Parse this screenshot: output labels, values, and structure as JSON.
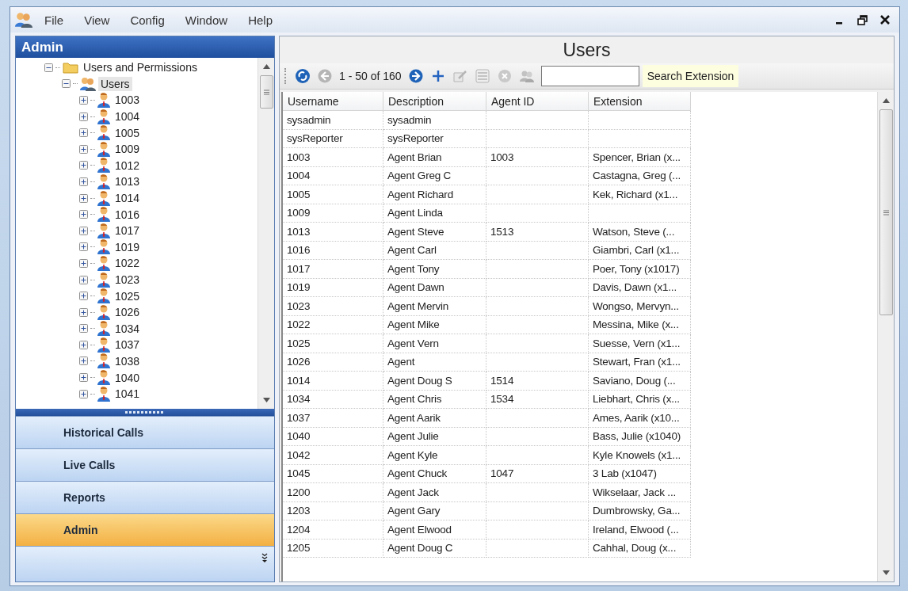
{
  "menu": {
    "items": [
      "File",
      "View",
      "Config",
      "Window",
      "Help"
    ]
  },
  "sidebar": {
    "title": "Admin",
    "tree": [
      {
        "label": "Users and Permissions",
        "kind": "folder",
        "expanded": true,
        "selected": false,
        "children": [
          {
            "label": "Users",
            "kind": "group",
            "expanded": true,
            "selected": true,
            "children": [
              {
                "label": "1003",
                "kind": "user",
                "expanded": false,
                "selected": false
              },
              {
                "label": "1004",
                "kind": "user",
                "expanded": false,
                "selected": false
              },
              {
                "label": "1005",
                "kind": "user",
                "expanded": false,
                "selected": false
              },
              {
                "label": "1009",
                "kind": "user",
                "expanded": false,
                "selected": false
              },
              {
                "label": "1012",
                "kind": "user",
                "expanded": false,
                "selected": false
              },
              {
                "label": "1013",
                "kind": "user",
                "expanded": false,
                "selected": false
              },
              {
                "label": "1014",
                "kind": "user",
                "expanded": false,
                "selected": false
              },
              {
                "label": "1016",
                "kind": "user",
                "expanded": false,
                "selected": false
              },
              {
                "label": "1017",
                "kind": "user",
                "expanded": false,
                "selected": false
              },
              {
                "label": "1019",
                "kind": "user",
                "expanded": false,
                "selected": false
              },
              {
                "label": "1022",
                "kind": "user",
                "expanded": false,
                "selected": false
              },
              {
                "label": "1023",
                "kind": "user",
                "expanded": false,
                "selected": false
              },
              {
                "label": "1025",
                "kind": "user",
                "expanded": false,
                "selected": false
              },
              {
                "label": "1026",
                "kind": "user",
                "expanded": false,
                "selected": false
              },
              {
                "label": "1034",
                "kind": "user",
                "expanded": false,
                "selected": false
              },
              {
                "label": "1037",
                "kind": "user",
                "expanded": false,
                "selected": false
              },
              {
                "label": "1038",
                "kind": "user",
                "expanded": false,
                "selected": false
              },
              {
                "label": "1040",
                "kind": "user",
                "expanded": false,
                "selected": false
              },
              {
                "label": "1041",
                "kind": "user",
                "expanded": false,
                "selected": false
              }
            ]
          }
        ]
      }
    ],
    "nav": [
      {
        "label": "Historical Calls",
        "selected": false
      },
      {
        "label": "Live Calls",
        "selected": false
      },
      {
        "label": "Reports",
        "selected": false
      },
      {
        "label": "Admin",
        "selected": true
      }
    ]
  },
  "main": {
    "title": "Users",
    "toolbar": [
      {
        "kind": "refresh",
        "disabled": false
      },
      {
        "kind": "prev",
        "disabled": true
      },
      {
        "kind": "text",
        "text": "1 - 50 of 160"
      },
      {
        "kind": "next",
        "disabled": false
      },
      {
        "kind": "add",
        "disabled": false
      },
      {
        "kind": "edit",
        "disabled": true
      },
      {
        "kind": "list",
        "disabled": true
      },
      {
        "kind": "delete",
        "disabled": true
      },
      {
        "kind": "users",
        "disabled": true
      },
      {
        "kind": "search"
      },
      {
        "kind": "search_button",
        "text": "Search Extension"
      }
    ],
    "table": {
      "columns": [
        "Username",
        "Description",
        "Agent ID",
        "Extension"
      ],
      "rows": [
        [
          "sysadmin",
          "sysadmin",
          "",
          ""
        ],
        [
          "sysReporter",
          "sysReporter",
          "",
          ""
        ],
        [
          "1003",
          "Agent Brian",
          "1003",
          "Spencer, Brian (x..."
        ],
        [
          "1004",
          "Agent Greg C",
          "",
          "Castagna, Greg (..."
        ],
        [
          "1005",
          "Agent Richard",
          "",
          "Kek, Richard (x1..."
        ],
        [
          "1009",
          "Agent Linda",
          "",
          ""
        ],
        [
          "1013",
          "Agent Steve",
          "1513",
          "Watson, Steve (..."
        ],
        [
          "1016",
          "Agent Carl",
          "",
          "Giambri, Carl (x1..."
        ],
        [
          "1017",
          "Agent Tony",
          "",
          "Poer, Tony (x1017)"
        ],
        [
          "1019",
          "Agent Dawn",
          "",
          "Davis, Dawn (x1..."
        ],
        [
          "1023",
          "Agent Mervin",
          "",
          "Wongso, Mervyn..."
        ],
        [
          "1022",
          "Agent Mike",
          "",
          "Messina, Mike (x..."
        ],
        [
          "1025",
          "Agent Vern",
          "",
          "Suesse, Vern (x1..."
        ],
        [
          "1026",
          "Agent",
          "",
          "Stewart, Fran (x1..."
        ],
        [
          "1014",
          "Agent Doug S",
          "1514",
          "Saviano, Doug (..."
        ],
        [
          "1034",
          "Agent Chris",
          "1534",
          "Liebhart, Chris (x..."
        ],
        [
          "1037",
          "Agent Aarik",
          "",
          "Ames, Aarik (x10..."
        ],
        [
          "1040",
          "Agent Julie",
          "",
          "Bass, Julie (x1040)"
        ],
        [
          "1042",
          "Agent Kyle",
          "",
          "Kyle Knowels (x1..."
        ],
        [
          "1045",
          "Agent Chuck",
          "1047",
          "3 Lab (x1047)"
        ],
        [
          "1200",
          "Agent Jack",
          "",
          "Wikselaar, Jack ..."
        ],
        [
          "1203",
          "Agent Gary",
          "",
          "Dumbrowsky, Ga..."
        ],
        [
          "1204",
          "Agent Elwood",
          "",
          "Ireland, Elwood (..."
        ],
        [
          "1205",
          "Agent Doug C",
          "",
          "Cahhal, Doug (x..."
        ]
      ]
    }
  }
}
